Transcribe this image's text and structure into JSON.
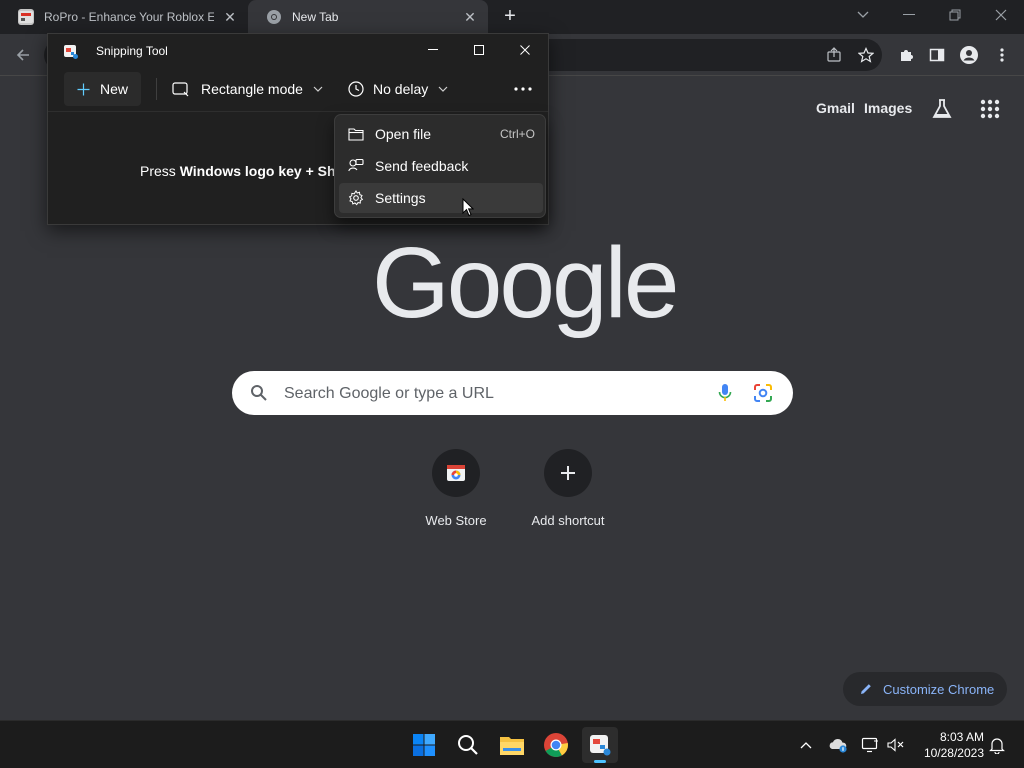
{
  "browser": {
    "tabs": [
      {
        "title": "RoPro - Enhance Your Roblox Experience",
        "active": false
      },
      {
        "title": "New Tab",
        "active": true
      }
    ],
    "new_tab_symbol": "+",
    "close_symbol": "✕"
  },
  "ntp": {
    "links": {
      "gmail": "Gmail",
      "images": "Images"
    },
    "logo_text": "Google",
    "search_placeholder": "Search Google or type a URL",
    "shortcuts": [
      {
        "label": "Web Store",
        "icon": "web-store-icon"
      },
      {
        "label": "Add shortcut",
        "icon": "plus-icon"
      }
    ],
    "customize_label": "Customize Chrome"
  },
  "snipping_tool": {
    "title": "Snipping Tool",
    "new_label": "New",
    "mode_label": "Rectangle mode",
    "delay_label": "No delay",
    "hint_prefix": "Press ",
    "hint_bold": "Windows logo key + Shift",
    "menu": [
      {
        "label": "Open file",
        "accelerator": "Ctrl+O",
        "icon": "folder-icon"
      },
      {
        "label": "Send feedback",
        "accelerator": "",
        "icon": "feedback-icon"
      },
      {
        "label": "Settings",
        "accelerator": "",
        "icon": "gear-icon"
      }
    ]
  },
  "taskbar": {
    "time": "8:03 AM",
    "date": "10/28/2023"
  },
  "colors": {
    "chrome_dark": "#202124",
    "ntp_bg": "#35363a",
    "accent_blue": "#8ab4f8",
    "taskbar_accent": "#4cc2ff"
  }
}
